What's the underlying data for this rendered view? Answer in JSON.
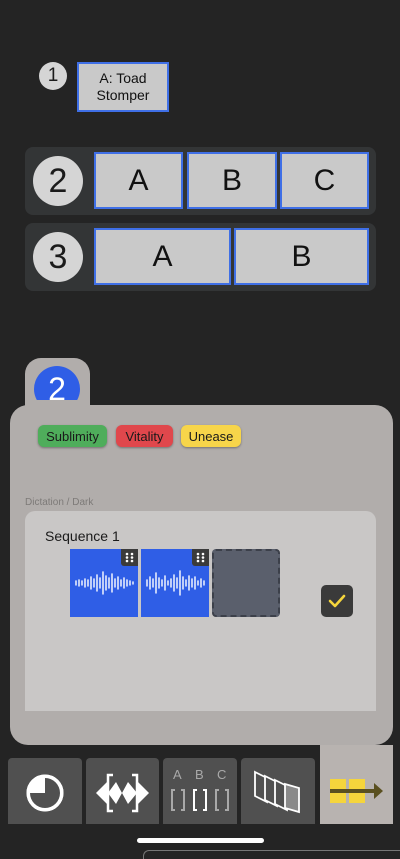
{
  "row1": {
    "number": "1",
    "option_label": "A: Toad\nStomper"
  },
  "row2": {
    "number": "2",
    "options": [
      "A",
      "B",
      "C"
    ]
  },
  "row3": {
    "number": "3",
    "options": [
      "A",
      "B"
    ]
  },
  "panel": {
    "tab_number": "2",
    "tags": [
      {
        "label": "Sublimity",
        "color": "#4fad5b"
      },
      {
        "label": "Vitality",
        "color": "#e0474c"
      },
      {
        "label": "Unease",
        "color": "#f7d54a"
      }
    ],
    "section_label": "Dictation / Dark",
    "sequence_title": "Sequence 1",
    "confirm_checked": true
  },
  "toolbar": {
    "abc_letters": [
      "A",
      "B",
      "C"
    ],
    "active_tool": "sequence-arrow-tool"
  },
  "colors": {
    "background": "#242424",
    "accent_blue": "#2f5ee6",
    "box_border": "#3f6fe6",
    "panel_gray": "#b1adab",
    "toolbar_active": "#b8b3b0",
    "highlight_yellow": "#f5d53c"
  }
}
